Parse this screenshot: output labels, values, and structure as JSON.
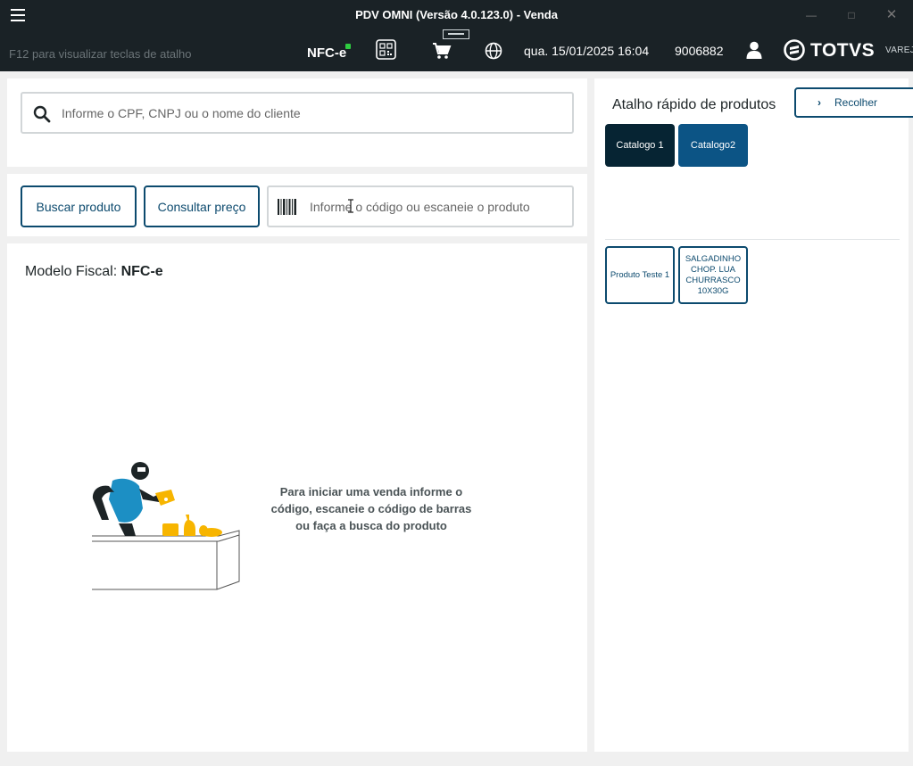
{
  "window": {
    "title": "PDV OMNI (Versão 4.0.123.0) - Venda"
  },
  "header": {
    "shortcut_hint": "F12 para visualizar teclas de atalho",
    "fiscal_badge": "NFC-e",
    "datetime": "qua. 15/01/2025 16:04",
    "terminal_id": "9006882",
    "logo_text": "TOTVS",
    "logo_sub": "VAREJO",
    "status_color": "#2ecc40"
  },
  "customer_search": {
    "placeholder": "Informe o CPF, CNPJ ou o nome do cliente"
  },
  "actions": {
    "search_product": "Buscar produto",
    "check_price": "Consultar preço",
    "code_placeholder": "Informe o código ou escaneie o produto"
  },
  "sale": {
    "fiscal_label": "Modelo Fiscal: ",
    "fiscal_value": "NFC-e",
    "empty_message": "Para iniciar uma venda informe o código, escaneie o código de barras ou faça a busca do produto"
  },
  "shortcuts": {
    "title": "Atalho rápido de produtos",
    "collapse_label": "Recolher",
    "catalogs": [
      {
        "label": "Catalogo 1",
        "color": "#062433"
      },
      {
        "label": "Catalogo2",
        "color": "#0c5485"
      }
    ],
    "products": [
      {
        "label": "Produto Teste 1"
      },
      {
        "label": "SALGADINHO CHOP. LUA CHURRASCO 10X30G"
      }
    ]
  },
  "colors": {
    "primary": "#0c4a6e",
    "titlebar": "#1a2226",
    "accent": "#f7b500",
    "figure_shirt": "#1c8fc4"
  }
}
